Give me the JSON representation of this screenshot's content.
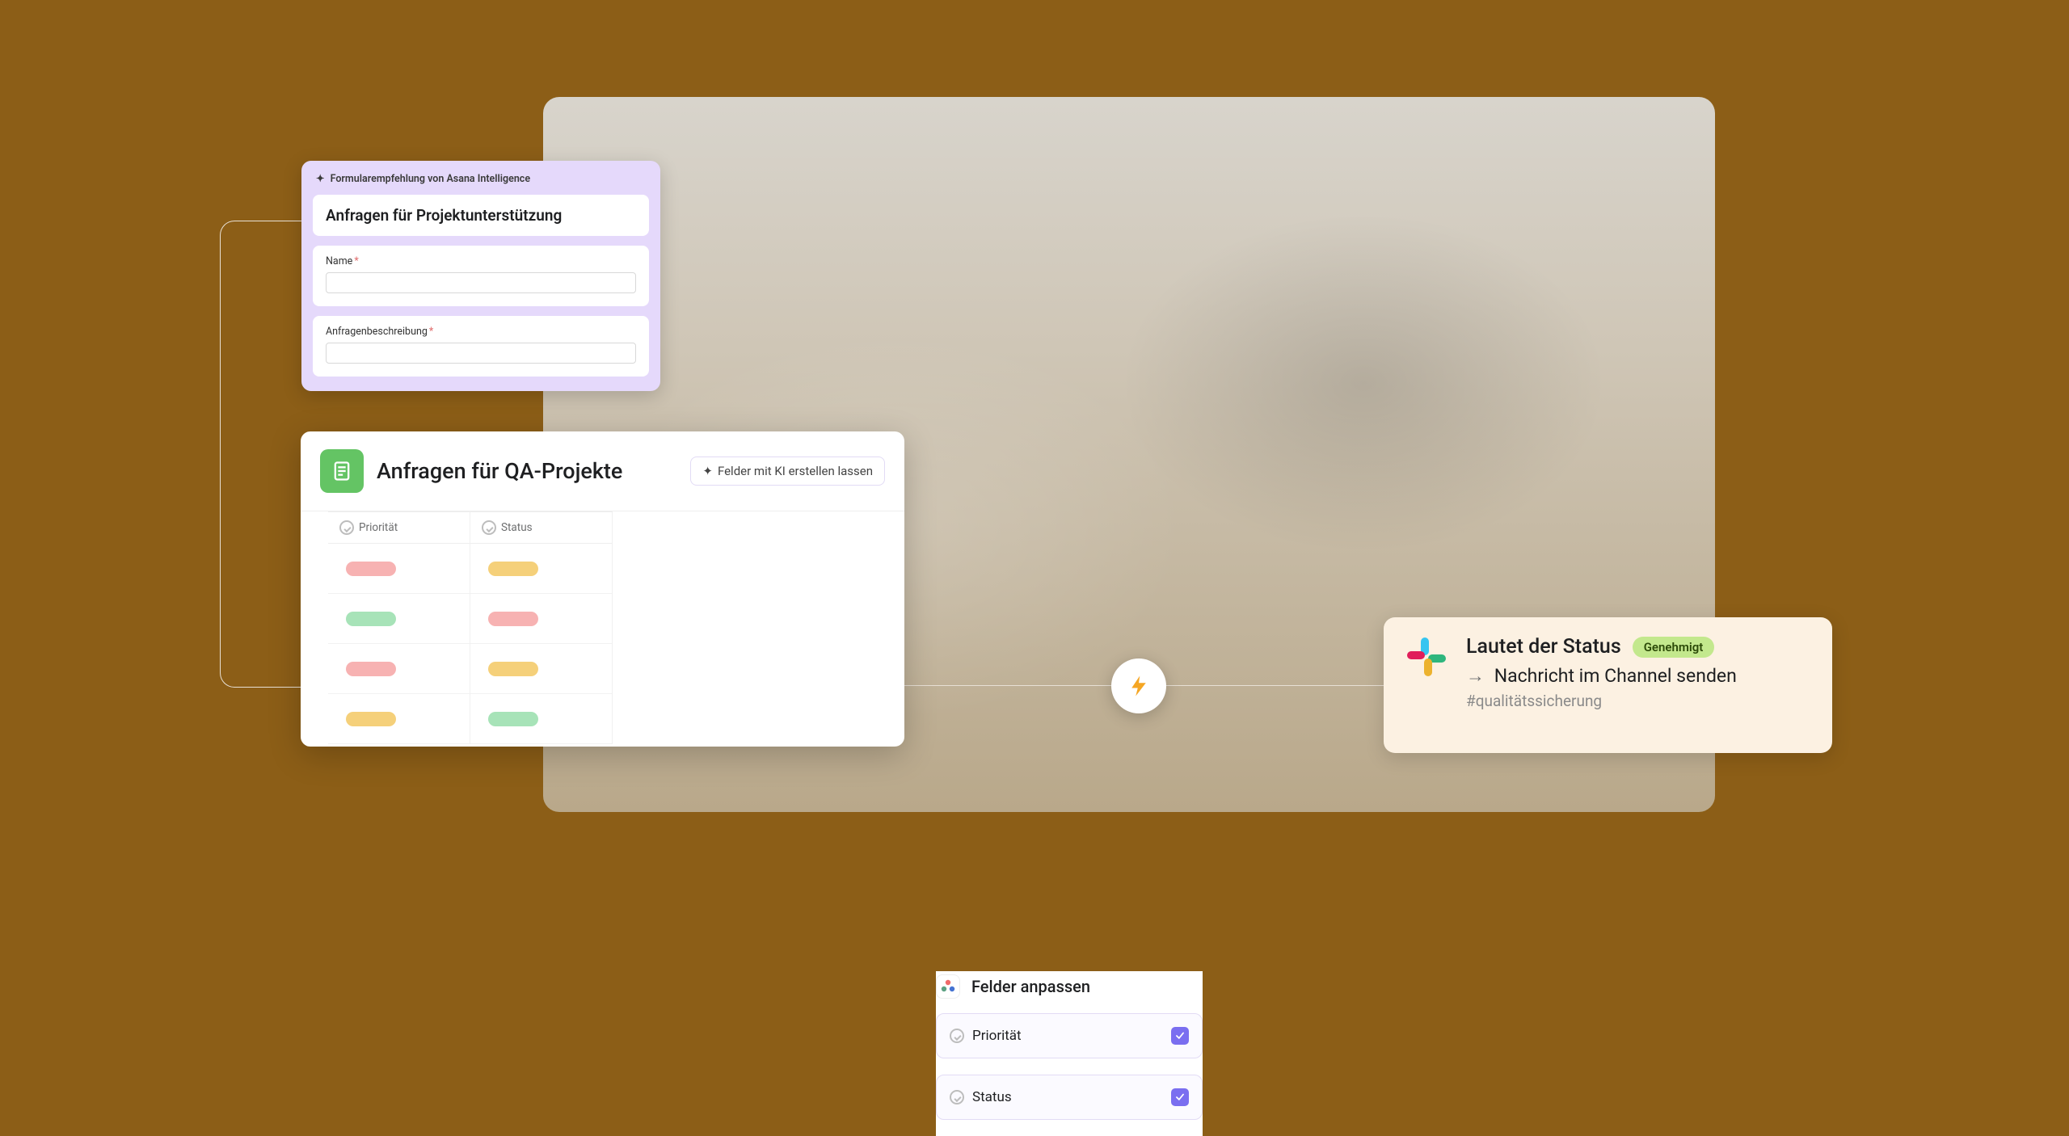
{
  "form": {
    "recommendation_label": "Formularempfehlung von Asana Intelligence",
    "title": "Anfragen für Projektunterstützung",
    "fields": [
      {
        "label": "Name",
        "required": true
      },
      {
        "label": "Anfragenbeschreibung",
        "required": true
      }
    ]
  },
  "project": {
    "title": "Anfragen für QA-Projekte",
    "ai_fields_button": "Felder mit KI erstellen lassen",
    "columns": [
      "Priorität",
      "Status"
    ],
    "rows": [
      {
        "priority": "red",
        "status": "orange"
      },
      {
        "priority": "green",
        "status": "red"
      },
      {
        "priority": "red",
        "status": "orange"
      },
      {
        "priority": "orange",
        "status": "green"
      }
    ]
  },
  "fields_panel": {
    "title": "Felder anpassen",
    "items": [
      {
        "label": "Priorität",
        "checked": true
      },
      {
        "label": "Status",
        "checked": true
      }
    ]
  },
  "slack": {
    "title": "Lautet der Status",
    "badge": "Genehmigt",
    "action": "Nachricht im Channel senden",
    "channel": "#qualitätssicherung"
  }
}
